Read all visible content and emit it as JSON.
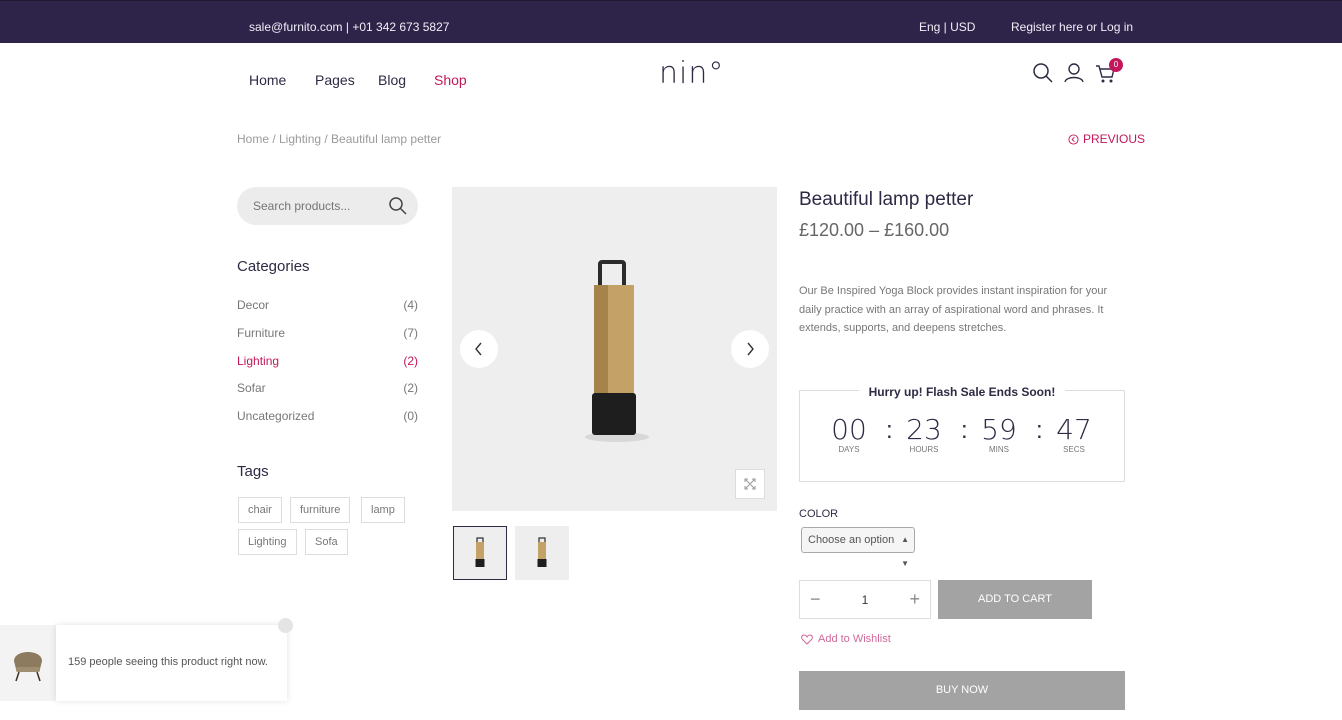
{
  "topbar": {
    "contact": "sale@furnito.com  |  +01 342 673 5827",
    "lang_currency": "Eng  |  USD",
    "account": "Register here or Log in"
  },
  "nav": {
    "items": [
      "Home",
      "Pages",
      "Blog",
      "Shop"
    ],
    "active": "Shop"
  },
  "logo": "nin°",
  "cart": {
    "count": "0"
  },
  "breadcrumb": "Home / Lighting / Beautiful lamp petter",
  "previous_label": "PREVIOUS",
  "search": {
    "placeholder": "Search products..."
  },
  "categories": {
    "title": "Categories",
    "items": [
      {
        "name": "Decor",
        "count": "(4)"
      },
      {
        "name": "Furniture",
        "count": "(7)"
      },
      {
        "name": "Lighting",
        "count": "(2)"
      },
      {
        "name": "Sofar",
        "count": "(2)"
      },
      {
        "name": "Uncategorized",
        "count": "(0)"
      }
    ],
    "active": "Lighting"
  },
  "tags": {
    "title": "Tags",
    "items": [
      "chair",
      "furniture",
      "lamp",
      "Lighting",
      "Sofa"
    ]
  },
  "product": {
    "title": "Beautiful lamp petter",
    "price": "£120.00 – £160.00",
    "description": "Our Be Inspired Yoga Block provides instant inspiration for your daily practice with an array of aspirational word and phrases. It extends, supports, and deepens stretches."
  },
  "flash_sale": {
    "title": "Hurry up! Flash Sale Ends Soon!",
    "days": "00",
    "days_label": "DAYS",
    "hours": "23",
    "hours_label": "HOURS",
    "mins": "59",
    "mins_label": "MINS",
    "secs": "47",
    "secs_label": "SECS",
    "separator": ":"
  },
  "color": {
    "label": "COLOR",
    "selected": "Choose an option"
  },
  "quantity": {
    "value": "1",
    "minus": "−",
    "plus": "+"
  },
  "add_to_cart": "ADD TO CART",
  "wishlist": "Add to Wishlist",
  "buy_now": "BUY NOW",
  "popup": {
    "message": "159 people seeing this product right now."
  },
  "colors": {
    "topbar": "#2e2449",
    "accent": "#c2185b",
    "button": "#a3a3a3"
  }
}
